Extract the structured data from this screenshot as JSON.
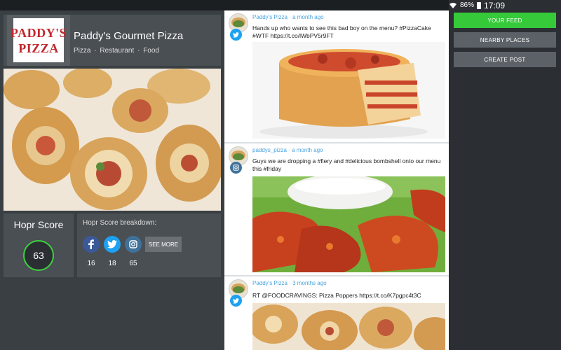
{
  "status_bar": {
    "battery": "86%",
    "time": "17:09"
  },
  "business": {
    "logo_text": [
      "PADDY'S",
      "PIZZA"
    ],
    "name": "Paddy's Gourmet Pizza",
    "categories": [
      "Pizza",
      "Restaurant",
      "Food"
    ],
    "category_separator": "·"
  },
  "score": {
    "title": "Hopr Score",
    "value": "63"
  },
  "breakdown": {
    "title": "Hopr Score breakdown:",
    "facebook_count": "16",
    "twitter_count": "18",
    "instagram_count": "65",
    "see_more_label": "SEE MORE"
  },
  "feed": {
    "posts": [
      {
        "author": "Paddy's Pizza",
        "time": "a month ago",
        "source": "twitter",
        "text": "Hands up who wants to see this bad boy on the menu? #PizzaCake #WTF https://t.co/lWbPV5r9FT"
      },
      {
        "author": "paddys_pizza",
        "time": "a month ago",
        "source": "instagram",
        "text": "Guys we are dropping a #fiery and #delicious bombshell onto our menu this #friday"
      },
      {
        "author": "Paddy's Pizza",
        "time": "3 months ago",
        "source": "twitter",
        "text": "RT @FOODCRAVINGS: Pizza Poppers https://t.co/K7pgpc4t3C"
      }
    ],
    "meta_separator": " · "
  },
  "nav": {
    "your_feed": "YOUR FEED",
    "nearby_places": "NEARBY PLACES",
    "create_post": "CREATE POST"
  },
  "colors": {
    "accent_green": "#36c93a",
    "facebook": "#3b5998",
    "twitter": "#1da1f2",
    "instagram": "#3f729b"
  }
}
